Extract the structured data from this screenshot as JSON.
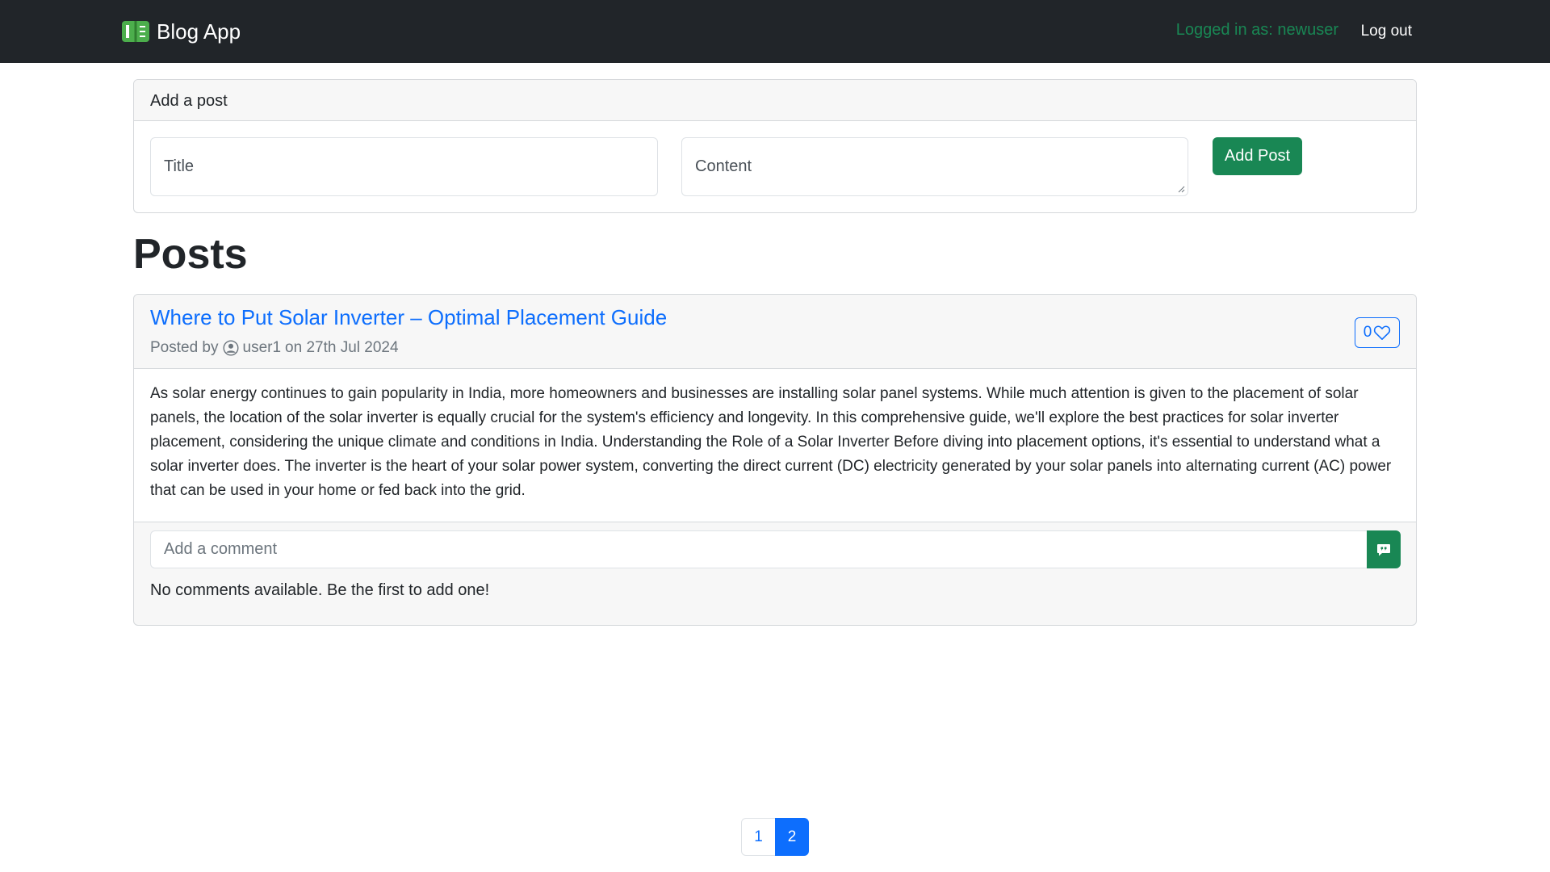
{
  "navbar": {
    "brand": "Blog App",
    "brand_icon": "book-icon",
    "logged_in_text": "Logged in as: newuser",
    "logout_label": "Log out",
    "background": "#212529",
    "logged_in_color": "#198754"
  },
  "add_post": {
    "header": "Add a post",
    "title_placeholder": "Title",
    "content_placeholder": "Content",
    "submit_label": "Add Post",
    "button_color": "#198754"
  },
  "posts_heading": "Posts",
  "post": {
    "title": "Where to Put Solar Inverter – Optimal Placement Guide",
    "posted_by_label": "Posted by",
    "author": "user1",
    "date_text": "on 27th Jul 2024",
    "likes": "0",
    "like_icon": "heart-icon",
    "body": "As solar energy continues to gain popularity in India, more homeowners and businesses are installing solar panel systems. While much attention is given to the placement of solar panels, the location of the solar inverter is equally crucial for the system's efficiency and longevity. In this comprehensive guide, we'll explore the best practices for solar inverter placement, considering the unique climate and conditions in India. Understanding the Role of a Solar Inverter Before diving into placement options, it's essential to understand what a solar inverter does. The inverter is the heart of your solar power system, converting the direct current (DC) electricity generated by your solar panels into alternating current (AC) power that can be used in your home or fed back into the grid.",
    "comment_placeholder": "Add a comment",
    "comment_icon": "chat-quote-icon",
    "no_comments": "No comments available. Be the first to add one!"
  },
  "pagination": {
    "pages": [
      "1",
      "2"
    ],
    "current": "2",
    "active_color": "#0d6efd"
  }
}
